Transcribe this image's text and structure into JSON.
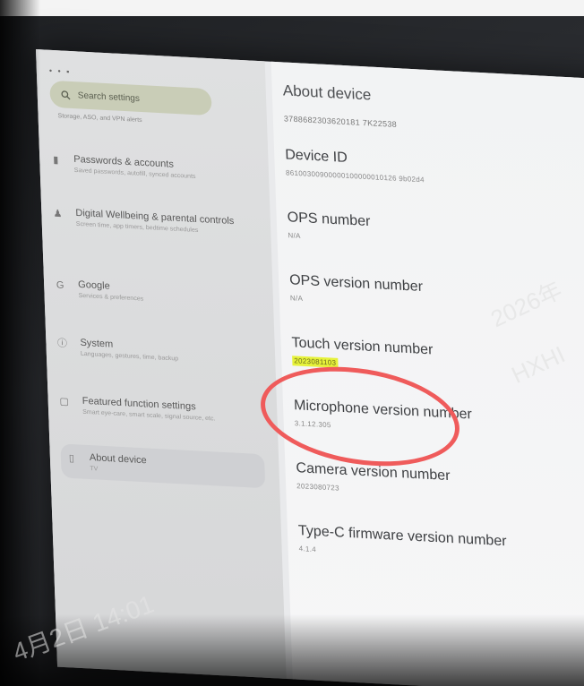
{
  "sidebar": {
    "status": "• • ▪",
    "search_placeholder": "Search settings",
    "top_sub": "Storage, ASO, and VPN alerts",
    "items": [
      {
        "icon": "key-icon",
        "glyph": "▮",
        "title": "Passwords & accounts",
        "sub": "Saved passwords, autofill, synced accounts"
      },
      {
        "icon": "wellbeing-icon",
        "glyph": "♟",
        "title": "Digital Wellbeing & parental controls",
        "sub": "Screen time, app timers, bedtime schedules"
      },
      {
        "icon": "google-icon",
        "glyph": "G",
        "title": "Google",
        "sub": "Services & preferences"
      },
      {
        "icon": "system-icon",
        "glyph": "ⓘ",
        "title": "System",
        "sub": "Languages, gestures, time, backup"
      },
      {
        "icon": "featured-icon",
        "glyph": "▢",
        "title": "Featured function settings",
        "sub": "Smart eye-care, smart scale, signal source, etc."
      },
      {
        "icon": "device-icon",
        "glyph": "▯",
        "title": "About device",
        "sub": "TV"
      }
    ]
  },
  "main": {
    "title": "About device",
    "serial": "3788682303620181 7K22538",
    "items": [
      {
        "label": "Device ID",
        "value": "86100300900000100000010126 9b02d4"
      },
      {
        "label": "OPS number",
        "value": "N/A"
      },
      {
        "label": "OPS version number",
        "value": "N/A"
      },
      {
        "label": "Touch version number",
        "value": "2023081103"
      },
      {
        "label": "Microphone version number",
        "value": "3.1.12.305"
      },
      {
        "label": "Camera version number",
        "value": "2023080723"
      },
      {
        "label": "Type-C firmware version number",
        "value": "4.1.4"
      }
    ]
  },
  "watermark": {
    "bottom": "4月2日 14:01",
    "right_1": "2026年",
    "right_2": "HXHI"
  },
  "colors": {
    "annotation_ring": "#ef5b5b",
    "highlight": "#e6f23a"
  }
}
